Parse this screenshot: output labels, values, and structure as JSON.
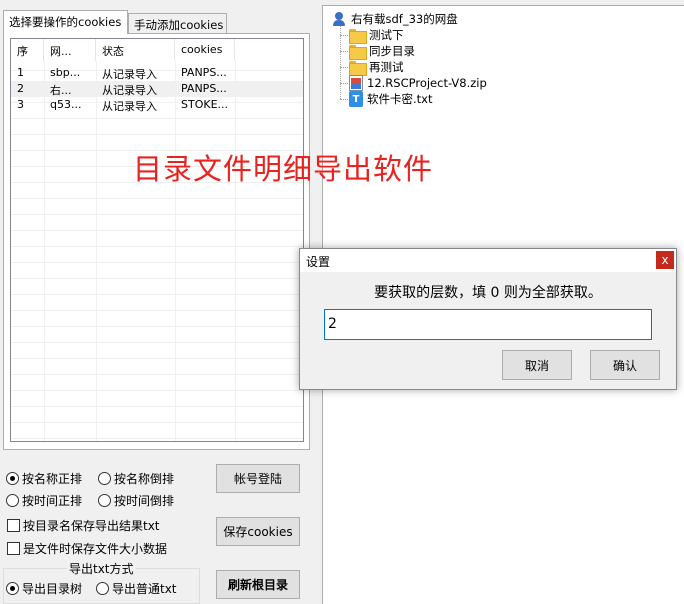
{
  "tabs": [
    {
      "label": "选择要操作的cookies"
    },
    {
      "label": "手动添加cookies"
    }
  ],
  "cookie_list": {
    "columns": [
      "序",
      "网...",
      "状态",
      "cookies"
    ],
    "rows": [
      [
        "1",
        "sbp...",
        "从记录导入",
        "PANPS..."
      ],
      [
        "2",
        "右...",
        "从记录导入",
        "PANPS..."
      ],
      [
        "3",
        "q53...",
        "从记录导入",
        "STOKE..."
      ]
    ]
  },
  "tree": {
    "root": "右有载sdf_33的网盘",
    "children": [
      {
        "label": "测试下",
        "icon": "folder-icon"
      },
      {
        "label": "同步目录",
        "icon": "folder-icon"
      },
      {
        "label": "再测试",
        "icon": "folder-icon"
      },
      {
        "label": "12.RSCProject-V8.zip",
        "icon": "zip-file-icon"
      },
      {
        "label": "软件卡密.txt",
        "icon": "text-file-icon"
      }
    ]
  },
  "banner": "目录文件明细导出软件",
  "sort": {
    "name_asc": "按名称正排",
    "name_desc": "按名称倒排",
    "time_asc": "按时间正排",
    "time_desc": "按时间倒排",
    "selected": "name_asc"
  },
  "options": {
    "save_by_dir": "按目录名保存导出结果txt",
    "save_file_size": "是文件时保存文件大小数据"
  },
  "export_mode": {
    "title": "导出txt方式",
    "tree": "导出目录树",
    "plain": "导出普通txt",
    "selected": "tree"
  },
  "buttons": {
    "login": "帐号登陆",
    "save_cookies": "保存cookies",
    "refresh_root": "刷新根目录"
  },
  "dialog": {
    "title": "设置",
    "close": "x",
    "prompt": "要获取的层数，填 0 则为全部获取。",
    "value": "2",
    "cancel": "取消",
    "confirm": "确认"
  }
}
